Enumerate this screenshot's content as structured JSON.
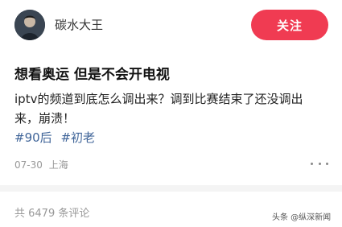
{
  "author": {
    "name": "碳水大王",
    "avatar_icon": "user-avatar"
  },
  "header": {
    "follow_label": "关注"
  },
  "post": {
    "title": "想看奥运 但是不会开电视",
    "body_line1": "iptv的频道到底怎么调出来？调到比赛结束了还没调出",
    "body_line2": "来，崩溃！",
    "hashtags": [
      "#90后",
      "#初老"
    ],
    "date": "07-30",
    "location": "上海"
  },
  "comments": {
    "count_text": "共 6479 条评论"
  },
  "watermark": {
    "text": "头条 @纵深新闻"
  },
  "colors": {
    "accent": "#f03b52",
    "hashtag": "#406599",
    "meta": "#999999"
  }
}
